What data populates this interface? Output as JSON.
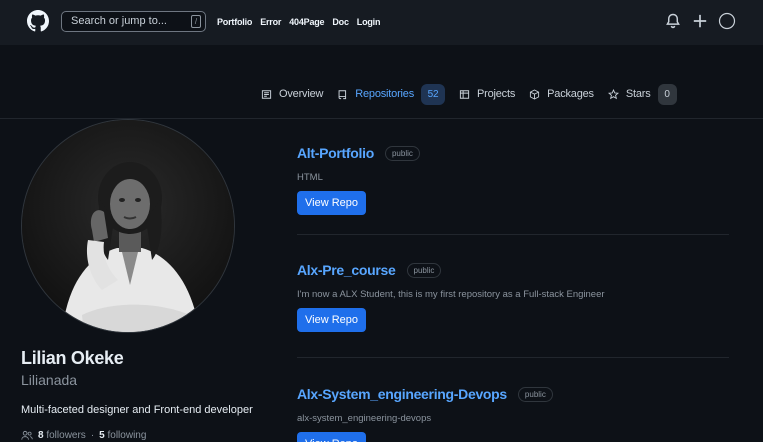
{
  "header": {
    "search_placeholder": "Search or jump to...",
    "slash_key": "/",
    "nav": [
      "Portfolio",
      "Error",
      "404Page",
      "Doc",
      "Login"
    ]
  },
  "tabs": [
    {
      "label": "Overview",
      "icon": "book-icon"
    },
    {
      "label": "Repositories",
      "icon": "repo-icon",
      "count": "52",
      "active": true
    },
    {
      "label": "Projects",
      "icon": "table-icon"
    },
    {
      "label": "Packages",
      "icon": "package-icon"
    },
    {
      "label": "Stars",
      "icon": "star-icon",
      "count": "0"
    }
  ],
  "profile": {
    "name": "Lilian Okeke",
    "username": "Lilianada",
    "bio": "Multi-faceted designer and Front-end developer",
    "followers_count": "8",
    "followers_label": "followers",
    "separator": "·",
    "following_count": "5",
    "following_label": "following"
  },
  "repos": [
    {
      "name": "Alt-Portfolio",
      "visibility": "public",
      "description": "HTML",
      "button": "View Repo"
    },
    {
      "name": "Alx-Pre_course",
      "visibility": "public",
      "description": "I'm now a ALX Student, this is my first repository as a Full-stack Engineer",
      "button": "View Repo"
    },
    {
      "name": "Alx-System_engineering-Devops",
      "visibility": "public",
      "description": "alx-system_engineering-devops",
      "button": "View Repo"
    }
  ],
  "colors": {
    "background": "#0d1117",
    "header": "#161b22",
    "accent": "#58a6ff",
    "button": "#1f6feb"
  }
}
